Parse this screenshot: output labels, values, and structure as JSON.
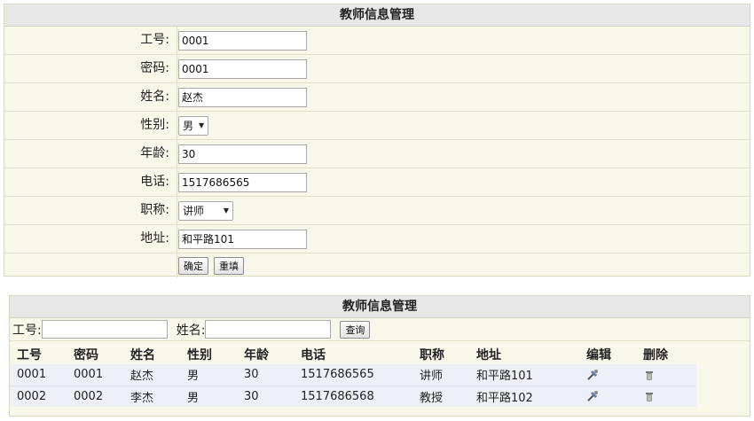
{
  "form": {
    "title": "教师信息管理",
    "fields": [
      {
        "label": "工号:",
        "value": "0001"
      },
      {
        "label": "密码:",
        "value": "0001"
      },
      {
        "label": "姓名:",
        "value": "赵杰"
      },
      {
        "label": "性别:",
        "value": "男"
      },
      {
        "label": "年龄:",
        "value": "30"
      },
      {
        "label": "电话:",
        "value": "1517686565"
      },
      {
        "label": "职称:",
        "value": "讲师"
      },
      {
        "label": "地址:",
        "value": "和平路101"
      }
    ],
    "confirm_label": "确定",
    "reset_label": "重填"
  },
  "list": {
    "title": "教师信息管理",
    "search": {
      "id_label": "工号:",
      "id_value": "",
      "name_label": "姓名:",
      "name_value": "",
      "query_label": "查询"
    },
    "columns": [
      "工号",
      "密码",
      "姓名",
      "性别",
      "年龄",
      "电话",
      "职称",
      "地址",
      "编辑",
      "删除"
    ],
    "rows": [
      {
        "id": "0001",
        "password": "0001",
        "name": "赵杰",
        "gender": "男",
        "age": "30",
        "phone": "1517686565",
        "title": "讲师",
        "address": "和平路101",
        "edit_icon": "edit-icon",
        "delete_icon": "trash-icon"
      },
      {
        "id": "0002",
        "password": "0002",
        "name": "李杰",
        "gender": "男",
        "age": "30",
        "phone": "1517686568",
        "title": "教授",
        "address": "和平路102",
        "edit_icon": "edit-icon",
        "delete_icon": "trash-icon"
      }
    ]
  }
}
